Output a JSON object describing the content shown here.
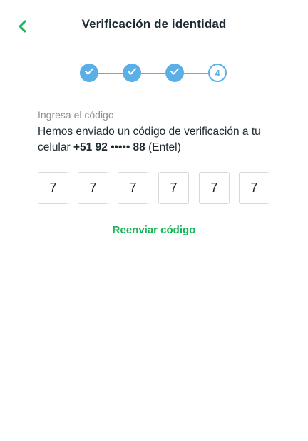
{
  "header": {
    "title": "Verificación de identidad",
    "back_icon": "chevron-left-icon",
    "accent_color": "#19b35a"
  },
  "stepper": {
    "total_steps": 4,
    "current_step": 4,
    "current_step_label": "4",
    "step_color": "#5aafe6"
  },
  "verification": {
    "label": "Ingresa el código",
    "description_prefix": "Hemos enviado un código de verificación a tu celular ",
    "phone": "+51 92 ••••• 88",
    "carrier": " (Entel)",
    "digits": [
      "7",
      "7",
      "7",
      "7",
      "7",
      "7"
    ]
  },
  "resend": {
    "label": "Reenviar código"
  }
}
